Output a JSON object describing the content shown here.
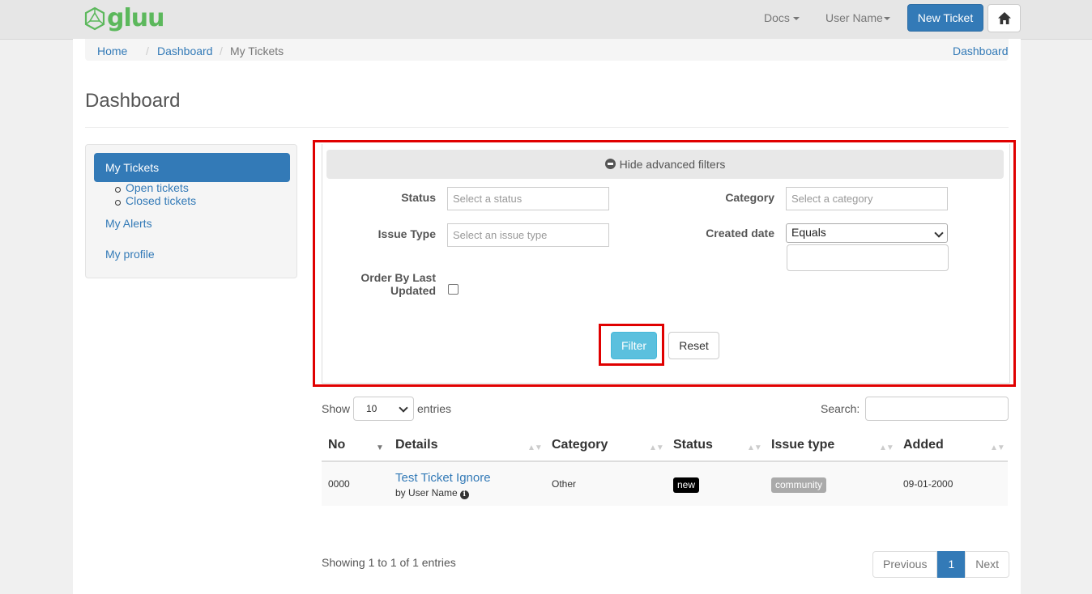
{
  "navbar": {
    "logo_text": "gluu",
    "docs": "Docs",
    "user": "User Name",
    "new_ticket": "New Ticket"
  },
  "breadcrumb": {
    "home": "Home",
    "dashboard": "Dashboard",
    "current": "My Tickets",
    "right_link": "Dashboard"
  },
  "page_title": "Dashboard",
  "sidebar": {
    "active": "My Tickets",
    "sub_items": [
      "Open tickets",
      "Closed tickets"
    ],
    "alerts": "My Alerts",
    "profile": "My profile"
  },
  "filters": {
    "toggle_label": "Hide advanced filters",
    "status_label": "Status",
    "status_placeholder": "Select a status",
    "category_label": "Category",
    "category_placeholder": "Select a category",
    "issue_type_label": "Issue Type",
    "issue_type_placeholder": "Select an issue type",
    "created_date_label": "Created date",
    "created_date_op": "Equals",
    "order_label_1": "Order By Last",
    "order_label_2": "Updated",
    "filter_button": "Filter",
    "reset_button": "Reset"
  },
  "table": {
    "show": "Show",
    "length": "10",
    "entries": "entries",
    "search_label": "Search:",
    "columns": [
      "No",
      "Details",
      "Category",
      "Status",
      "Issue type",
      "Added"
    ],
    "rows": [
      {
        "no": "0000",
        "title": "Test Ticket Ignore",
        "by": "by User Name",
        "category": "Other",
        "status": "new",
        "issue_type": "community",
        "added": "09-01-2000"
      }
    ],
    "info": "Showing 1 to 1 of 1 entries",
    "pagination": {
      "previous": "Previous",
      "page": "1",
      "next": "Next"
    }
  },
  "colors": {
    "primary": "#337ab7",
    "info": "#5bc0de",
    "highlight": "#e00000",
    "brand": "#5cb85c"
  }
}
